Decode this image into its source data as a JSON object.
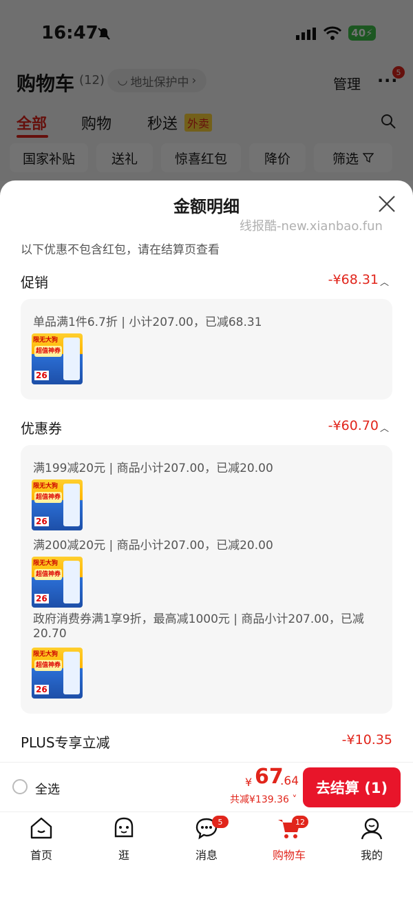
{
  "status_bar": {
    "time": "16:47",
    "battery": "40"
  },
  "header": {
    "title": "购物车",
    "count": "(12)",
    "address_pill": "地址保护中",
    "manage": "管理",
    "more_badge": "5"
  },
  "tabs": [
    {
      "label": "全部",
      "active": true
    },
    {
      "label": "购物"
    },
    {
      "label": "秒送",
      "tag": "外卖"
    }
  ],
  "filter_chips": [
    "国家补贴",
    "送礼",
    "惊喜红包",
    "降价",
    "筛选"
  ],
  "sheet": {
    "title": "金额明细",
    "watermark": "线报酷-new.xianbao.fun",
    "note": "以下优惠不包含红包，请在结算页查看",
    "promo": {
      "label": "促销",
      "amount": "-¥68.31",
      "rules": [
        "单品满1件6.7折 | 小计207.00，已减68.31"
      ]
    },
    "coupon": {
      "label": "优惠券",
      "amount": "-¥60.70",
      "rules": [
        "满199减20元 | 商品小计207.00，已减20.00",
        "满200减20元 | 商品小计207.00，已减20.00",
        "政府消费券满1享9折，最高减1000元 | 商品小计207.00，已减20.70"
      ]
    },
    "plus": {
      "label": "PLUS专享立减",
      "amount": "-¥10.35"
    }
  },
  "product_thumb": {
    "badge": "限无大狗",
    "banner": "超值神券",
    "price": "26"
  },
  "bottom_bar": {
    "select_all": "全选",
    "yen": "¥",
    "total_int": "67",
    "total_dec": ".64",
    "saved": "共减¥139.36",
    "checkout": "去结算 (1)"
  },
  "nav": [
    {
      "label": "首页",
      "icon": "home-icon"
    },
    {
      "label": "逛",
      "icon": "browse-icon"
    },
    {
      "label": "消息",
      "icon": "message-icon",
      "badge": "5"
    },
    {
      "label": "购物车",
      "icon": "cart-icon",
      "badge": "12",
      "active": true
    },
    {
      "label": "我的",
      "icon": "profile-icon"
    }
  ],
  "colors": {
    "accent": "#e1251b",
    "checkout": "#e8152a",
    "card_bg": "#f6f6f6"
  }
}
